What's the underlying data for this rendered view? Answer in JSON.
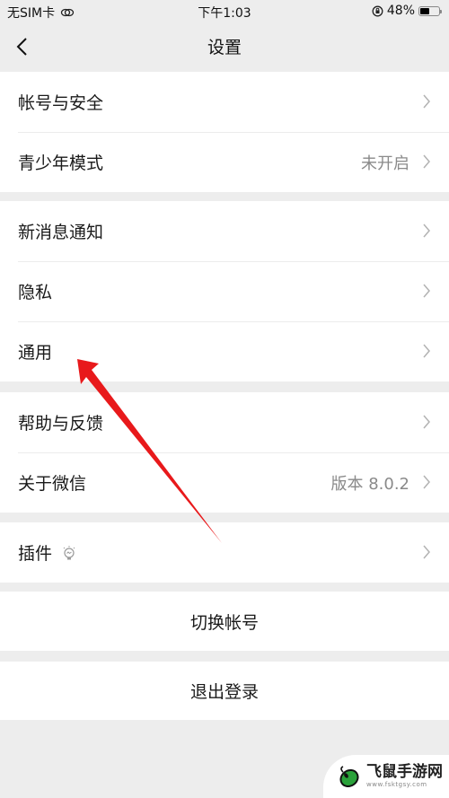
{
  "status_bar": {
    "carrier": "无SIM卡",
    "time": "下午1:03",
    "battery_percent": "48%",
    "battery_level": 0.48
  },
  "nav": {
    "title": "设置",
    "back_icon": "chevron-left-icon"
  },
  "groups": [
    {
      "items": [
        {
          "label": "帐号与安全",
          "value": null
        },
        {
          "label": "青少年模式",
          "value": "未开启"
        }
      ]
    },
    {
      "items": [
        {
          "label": "新消息通知",
          "value": null
        },
        {
          "label": "隐私",
          "value": null
        },
        {
          "label": "通用",
          "value": null
        }
      ]
    },
    {
      "items": [
        {
          "label": "帮助与反馈",
          "value": null
        },
        {
          "label": "关于微信",
          "value": "版本 8.0.2"
        }
      ]
    },
    {
      "items": [
        {
          "label": "插件",
          "value": null,
          "icon": "lightbulb-icon"
        }
      ]
    }
  ],
  "actions": {
    "switch_account": "切换帐号",
    "logout": "退出登录"
  },
  "annotation": {
    "arrow_color": "#e8191b",
    "points_to": "通用"
  },
  "watermark": {
    "name": "飞鼠手游网",
    "url": "www.fsktgsy.com",
    "accent": "#2aa13a"
  }
}
